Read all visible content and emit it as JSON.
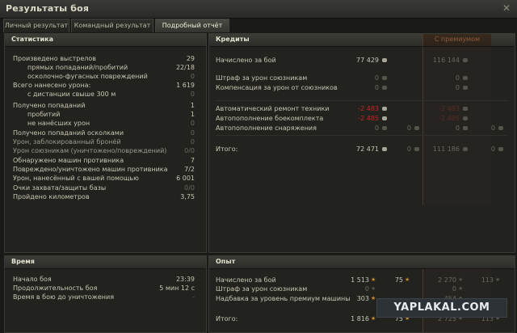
{
  "window": {
    "title": "Результаты боя"
  },
  "tabs": [
    {
      "label": "Личный результат"
    },
    {
      "label": "Командный результат"
    },
    {
      "label": "Подробный отчёт"
    }
  ],
  "stats": {
    "title": "Статистика",
    "rows": [
      {
        "label": "Произведено выстрелов",
        "value": "29"
      },
      {
        "label": "прямых попаданий/пробитий",
        "value": "22/18"
      },
      {
        "label": "осколочно-фугасных повреждений",
        "value": "0"
      },
      {
        "label": "Всего нанесено урона:",
        "value": "1 619"
      },
      {
        "label": "с дистанции свыше 300 м",
        "value": "0"
      },
      {
        "label": "Получено попаданий",
        "value": "1"
      },
      {
        "label": "пробитий",
        "value": "1"
      },
      {
        "label": "не нанёсших урон",
        "value": "0"
      },
      {
        "label": "Получено попаданий осколками",
        "value": "0"
      },
      {
        "label": "Урон, заблокированный бронёй",
        "value": "0"
      },
      {
        "label": "Урон союзникам (уничтожено/повреждений)",
        "value": "0/0"
      },
      {
        "label": "Обнаружено машин противника",
        "value": "7"
      },
      {
        "label": "Повреждено/уничтожено машин противника",
        "value": "7/2"
      },
      {
        "label": "Урон, нанесённый с вашей помощью",
        "value": "6 001"
      },
      {
        "label": "Очки захвата/защиты базы",
        "value": "0/0"
      },
      {
        "label": "Пройдено километров",
        "value": "3,75"
      }
    ]
  },
  "credits": {
    "title": "Кредиты",
    "premium_label": "С премиумом",
    "rows": [
      {
        "label": "Начислено за бой",
        "base": "77 429",
        "premium": "116 144"
      },
      {
        "label": "Штраф за урон союзникам",
        "base": "0",
        "premium": "0"
      },
      {
        "label": "Компенсация за урон от союзников",
        "base": "0",
        "premium": "0"
      },
      {
        "label": "Автоматический ремонт техники",
        "base": "-2 483",
        "premium": "-2 483"
      },
      {
        "label": "Автопополнение боекомплекта",
        "base": "-2 485",
        "premium": "-2 485"
      },
      {
        "label": "Автопополнение снаряжения",
        "base": "0",
        "base_gold": "0",
        "premium": "0",
        "premium_gold": "0"
      },
      {
        "label": "Итого:",
        "base": "72 471",
        "base_gold": "0",
        "premium": "111 186",
        "premium_gold": "0"
      }
    ]
  },
  "time": {
    "title": "Время",
    "rows": [
      {
        "label": "Начало боя",
        "value": "23:39"
      },
      {
        "label": "Продолжительность боя",
        "value": "5 мин 12 с"
      },
      {
        "label": "Время в бою до уничтожения",
        "value": "-"
      }
    ]
  },
  "experience": {
    "title": "Опыт",
    "rows": [
      {
        "label": "Начислено за бой",
        "base": "1 513",
        "free": "75",
        "premium": "2 270",
        "premium_free": "113"
      },
      {
        "label": "Штраф за урон союзникам",
        "base": "0",
        "premium": "0"
      },
      {
        "label": "Надбавка за уровень премиум машины",
        "base": "303",
        "premium": "454"
      },
      {
        "label": "Итого:",
        "base": "1 816",
        "free": "75",
        "premium": "2 725",
        "premium_free": "113"
      }
    ]
  },
  "watermark": {
    "text": "YAPLAKAL.COM"
  },
  "icons": {
    "credit": "credit-coin-icon",
    "xp": "xp-star-icon",
    "gold": "gold-icon",
    "close": "close-icon"
  }
}
